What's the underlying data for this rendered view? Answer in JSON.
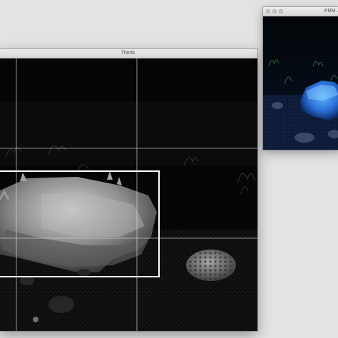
{
  "windows": {
    "thirds": {
      "title": "Thirds",
      "overlay": "rule-of-thirds-grid",
      "view": "grayscale-underwater-scene"
    },
    "prm": {
      "title": "PRM ...",
      "view": "color-underwater-scene"
    }
  },
  "colors": {
    "desktop_bg": "#e3e3e3",
    "titlebar": "#e4e4e4",
    "grid_line": "#d9d9d9",
    "selection_box": "#ffffff",
    "prm_accent": "#2f7fe0"
  }
}
